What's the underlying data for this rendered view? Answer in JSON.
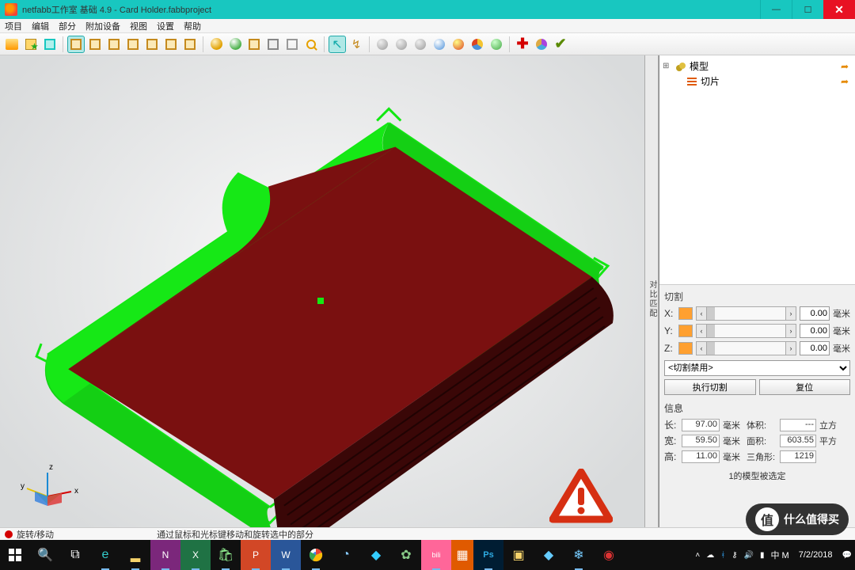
{
  "window": {
    "title": "netfabb工作室 基础 4.9 - Card Holder.fabbproject"
  },
  "menu": {
    "items": [
      "项目",
      "编辑",
      "部分",
      "附加设备",
      "视图",
      "设置",
      "帮助"
    ]
  },
  "collapse_label": "对比匹配",
  "tree": {
    "model_label": "模型",
    "slice_label": "切片"
  },
  "cut": {
    "title": "切割",
    "axes": {
      "x": {
        "label": "X:",
        "value": "0.00",
        "unit": "毫米"
      },
      "y": {
        "label": "Y:",
        "value": "0.00",
        "unit": "毫米"
      },
      "z": {
        "label": "Z:",
        "value": "0.00",
        "unit": "毫米"
      }
    },
    "mode": "<切割禁用>",
    "exec_label": "执行切割",
    "reset_label": "复位"
  },
  "info": {
    "title": "信息",
    "length": {
      "label": "长:",
      "value": "97.00",
      "unit": "毫米"
    },
    "width": {
      "label": "宽:",
      "value": "59.50",
      "unit": "毫米"
    },
    "height": {
      "label": "高:",
      "value": "11.00",
      "unit": "毫米"
    },
    "volume": {
      "label": "体积:",
      "value": "---",
      "unit": "立方"
    },
    "area": {
      "label": "面积:",
      "value": "603.55",
      "unit": "平方"
    },
    "tris": {
      "label": "三角形:",
      "value": "1219",
      "unit": ""
    },
    "footer": "1的模型被选定"
  },
  "status": {
    "mode": "旋转/移动",
    "hint": "通过鼠标和光标键移动和旋转选中的部分"
  },
  "tray": {
    "ime": "中 M",
    "date": "7/2/2018"
  },
  "watermark": "什么值得买"
}
